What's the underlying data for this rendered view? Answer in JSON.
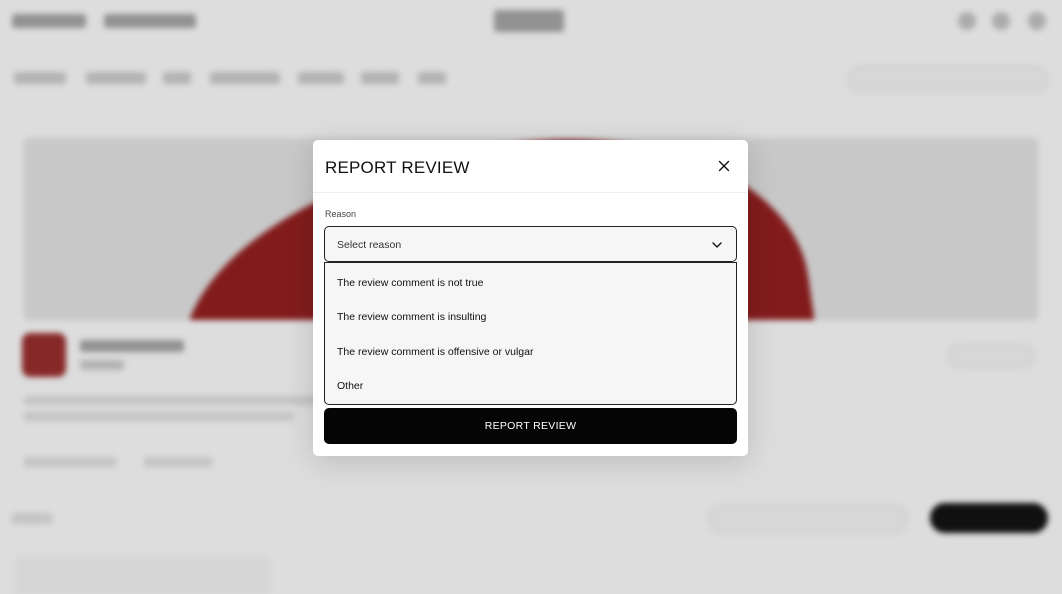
{
  "modal": {
    "title": "REPORT REVIEW",
    "reason_label": "Reason",
    "select_placeholder": "Select reason",
    "options": [
      "The review comment is not true",
      "The review comment is insulting",
      "The review comment is offensive or vulgar",
      "Other"
    ],
    "submit_label": "REPORT REVIEW"
  },
  "icons": {
    "close": "close-icon",
    "dropdown": "chevron-down-icon"
  },
  "colors": {
    "primary_button": "#050505",
    "modal_bg": "#ffffff",
    "select_bg": "#f6f6f6",
    "product_accent": "#8a1e1e"
  }
}
